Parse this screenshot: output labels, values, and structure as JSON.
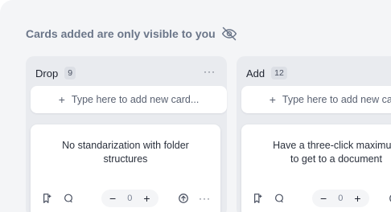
{
  "banner": {
    "text": "Cards added are only visible to you",
    "icon": "eye-off-icon"
  },
  "columns": [
    {
      "title": "Drop",
      "count": "9",
      "menu": "···",
      "add_placeholder": "Type here to add new card...",
      "card": {
        "text": "No standarization with folder structures",
        "vote_minus": "−",
        "vote_value": "0",
        "vote_plus": "+",
        "more": "···"
      }
    },
    {
      "title": "Add",
      "count": "12",
      "menu": "···",
      "add_placeholder": "Type here to add new card...",
      "card": {
        "text": "Have a three-click maximum\nto get to a document",
        "vote_minus": "−",
        "vote_value": "0",
        "vote_plus": "+",
        "more": "···"
      }
    }
  ],
  "colors": {
    "panel_bg": "#f4f5f7",
    "column_bg": "#e9ebef",
    "card_bg": "#ffffff",
    "muted_text": "#6b7689",
    "text": "#1f2430"
  }
}
